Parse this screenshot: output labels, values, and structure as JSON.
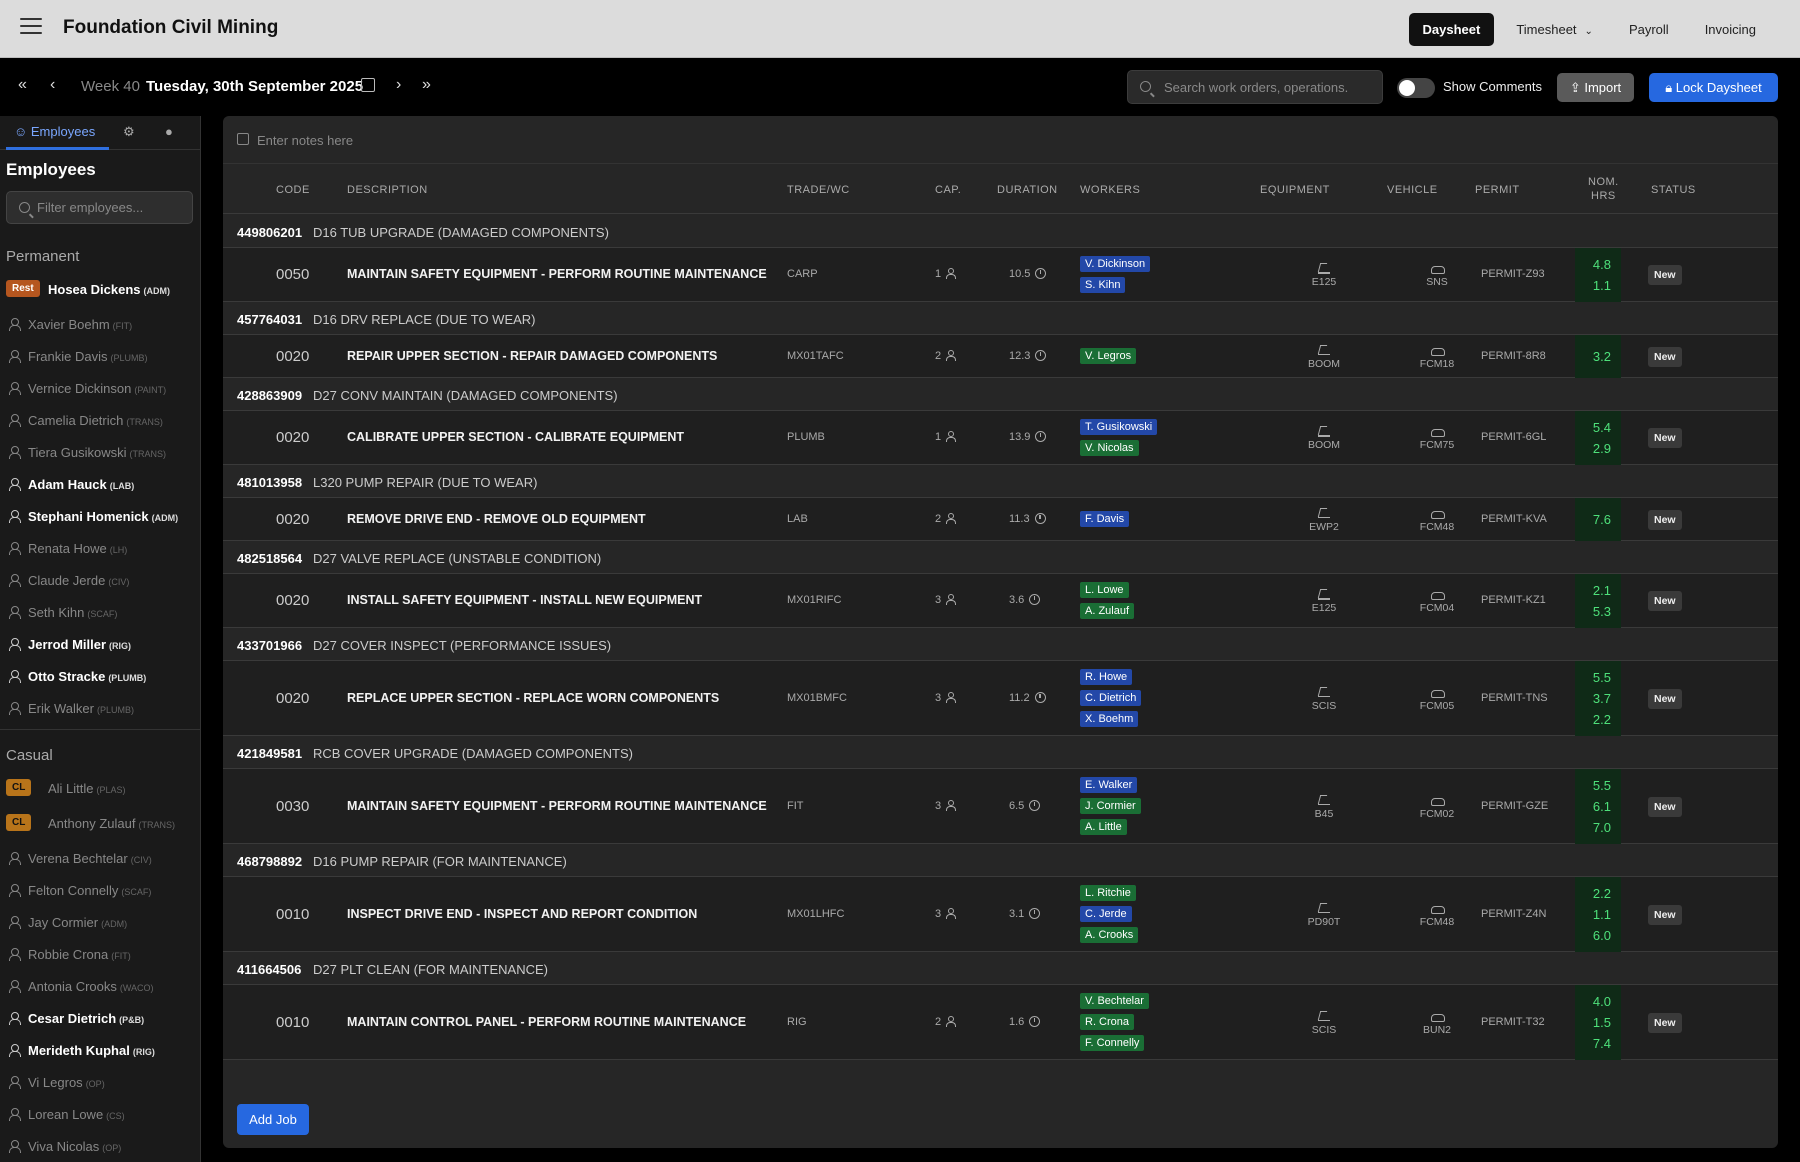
{
  "app": {
    "title": "Foundation Civil Mining"
  },
  "nav": [
    {
      "label": "Daysheet",
      "active": true
    },
    {
      "label": "Timesheet",
      "active": false,
      "dropdown": true
    },
    {
      "label": "Payroll",
      "active": false
    },
    {
      "label": "Invoicing",
      "active": false
    }
  ],
  "weekbar": {
    "week": "Week 40",
    "date": "Tuesday, 30th September 2025",
    "search_placeholder": "Search work orders, operations.",
    "toggle_label": "Show Comments",
    "toggle_on": false,
    "import_label": "Import",
    "lock_label": "Lock Daysheet"
  },
  "sidebar": {
    "tabs": [
      {
        "label": "Employees",
        "icon": "people-icon"
      },
      {
        "label": "",
        "icon": "excavator-icon"
      },
      {
        "label": "",
        "icon": "vehicle-icon"
      }
    ],
    "heading": "Employees",
    "filter_placeholder": "Filter employees...",
    "groups": [
      {
        "title": "Permanent",
        "employees": [
          {
            "name": "Hosea Dickens",
            "role": "(ADM)",
            "bold": true,
            "badge": "Rest"
          },
          {
            "name": "Xavier Boehm",
            "role": "(FIT)",
            "bold": false
          },
          {
            "name": "Frankie Davis",
            "role": "(PLUMB)",
            "bold": false
          },
          {
            "name": "Vernice Dickinson",
            "role": "(PAINT)",
            "bold": false
          },
          {
            "name": "Camelia Dietrich",
            "role": "(TRANS)",
            "bold": false
          },
          {
            "name": "Tiera Gusikowski",
            "role": "(TRANS)",
            "bold": false
          },
          {
            "name": "Adam Hauck",
            "role": "(LAB)",
            "bold": true
          },
          {
            "name": "Stephani Homenick",
            "role": "(ADM)",
            "bold": true
          },
          {
            "name": "Renata Howe",
            "role": "(LH)",
            "bold": false
          },
          {
            "name": "Claude Jerde",
            "role": "(CIV)",
            "bold": false
          },
          {
            "name": "Seth Kihn",
            "role": "(SCAF)",
            "bold": false
          },
          {
            "name": "Jerrod Miller",
            "role": "(RIG)",
            "bold": true
          },
          {
            "name": "Otto Stracke",
            "role": "(PLUMB)",
            "bold": true
          },
          {
            "name": "Erik Walker",
            "role": "(PLUMB)",
            "bold": false
          }
        ]
      },
      {
        "title": "Casual",
        "employees": [
          {
            "name": "Ali Little",
            "role": "(PLAS)",
            "bold": false,
            "badge": "CL"
          },
          {
            "name": "Anthony Zulauf",
            "role": "(TRANS)",
            "bold": false,
            "badge": "CL"
          },
          {
            "name": "Verena Bechtelar",
            "role": "(CIV)",
            "bold": false
          },
          {
            "name": "Felton Connelly",
            "role": "(SCAF)",
            "bold": false
          },
          {
            "name": "Jay Cormier",
            "role": "(ADM)",
            "bold": false
          },
          {
            "name": "Robbie Crona",
            "role": "(FIT)",
            "bold": false
          },
          {
            "name": "Antonia Crooks",
            "role": "(WACO)",
            "bold": false
          },
          {
            "name": "Cesar Dietrich",
            "role": "(P&B)",
            "bold": true
          },
          {
            "name": "Merideth Kuphal",
            "role": "(RIG)",
            "bold": true
          },
          {
            "name": "Vi Legros",
            "role": "(OP)",
            "bold": false
          },
          {
            "name": "Lorean Lowe",
            "role": "(CS)",
            "bold": false
          },
          {
            "name": "Viva Nicolas",
            "role": "(OP)",
            "bold": false
          }
        ]
      }
    ]
  },
  "main": {
    "notes_placeholder": "Enter notes here",
    "columns": {
      "code": "CODE",
      "description": "DESCRIPTION",
      "trade": "TRADE/WC",
      "cap": "CAP.",
      "duration": "DURATION",
      "workers": "WORKERS",
      "equipment": "EQUIPMENT",
      "vehicle": "VEHICLE",
      "permit": "PERMIT",
      "nom_hrs_1": "NOM.",
      "nom_hrs_2": "HRS",
      "status": "STATUS"
    },
    "work_orders": [
      {
        "wo": "449806201",
        "title": "D16 TUB UPGRADE (DAMAGED COMPONENTS)",
        "job": {
          "code": "0050",
          "desc": "MAINTAIN SAFETY EQUIPMENT - PERFORM ROUTINE MAINTENANCE",
          "trade": "CARP",
          "cap": "1",
          "duration": "10.5",
          "workers": [
            {
              "name": "V. Dickinson",
              "color": "blue"
            },
            {
              "name": "S. Kihn",
              "color": "blue"
            }
          ],
          "equipment": "E125",
          "vehicle": "SNS",
          "permit": "PERMIT-Z93",
          "hours": [
            "4.8",
            "1.1"
          ],
          "status": "New"
        }
      },
      {
        "wo": "457764031",
        "title": "D16 DRV REPLACE (DUE TO WEAR)",
        "job": {
          "code": "0020",
          "desc": "REPAIR UPPER SECTION - REPAIR DAMAGED COMPONENTS",
          "trade": "MX01TAFC",
          "cap": "2",
          "duration": "12.3",
          "workers": [
            {
              "name": "V. Legros",
              "color": "green"
            }
          ],
          "equipment": "BOOM",
          "vehicle": "FCM18",
          "permit": "PERMIT-8R8",
          "hours": [
            "3.2"
          ],
          "status": "New"
        }
      },
      {
        "wo": "428863909",
        "title": "D27 CONV MAINTAIN (DAMAGED COMPONENTS)",
        "job": {
          "code": "0020",
          "desc": "CALIBRATE UPPER SECTION - CALIBRATE EQUIPMENT",
          "trade": "PLUMB",
          "cap": "1",
          "duration": "13.9",
          "workers": [
            {
              "name": "T. Gusikowski",
              "color": "blue"
            },
            {
              "name": "V. Nicolas",
              "color": "green"
            }
          ],
          "equipment": "BOOM",
          "vehicle": "FCM75",
          "permit": "PERMIT-6GL",
          "hours": [
            "5.4",
            "2.9"
          ],
          "status": "New"
        }
      },
      {
        "wo": "481013958",
        "title": "L320 PUMP REPAIR (DUE TO WEAR)",
        "job": {
          "code": "0020",
          "desc": "REMOVE DRIVE END - REMOVE OLD EQUIPMENT",
          "trade": "LAB",
          "cap": "2",
          "duration": "11.3",
          "workers": [
            {
              "name": "F. Davis",
              "color": "blue"
            }
          ],
          "equipment": "EWP2",
          "vehicle": "FCM48",
          "permit": "PERMIT-KVA",
          "hours": [
            "7.6"
          ],
          "status": "New"
        }
      },
      {
        "wo": "482518564",
        "title": "D27 VALVE REPLACE (UNSTABLE CONDITION)",
        "job": {
          "code": "0020",
          "desc": "INSTALL SAFETY EQUIPMENT - INSTALL NEW EQUIPMENT",
          "trade": "MX01RIFC",
          "cap": "3",
          "duration": "3.6",
          "workers": [
            {
              "name": "L. Lowe",
              "color": "green"
            },
            {
              "name": "A. Zulauf",
              "color": "green"
            }
          ],
          "equipment": "E125",
          "vehicle": "FCM04",
          "permit": "PERMIT-KZ1",
          "hours": [
            "2.1",
            "5.3"
          ],
          "status": "New"
        }
      },
      {
        "wo": "433701966",
        "title": "D27 COVER INSPECT (PERFORMANCE ISSUES)",
        "job": {
          "code": "0020",
          "desc": "REPLACE UPPER SECTION - REPLACE WORN COMPONENTS",
          "trade": "MX01BMFC",
          "cap": "3",
          "duration": "11.2",
          "workers": [
            {
              "name": "R. Howe",
              "color": "blue"
            },
            {
              "name": "C. Dietrich",
              "color": "blue"
            },
            {
              "name": "X. Boehm",
              "color": "blue"
            }
          ],
          "equipment": "SCIS",
          "vehicle": "FCM05",
          "permit": "PERMIT-TNS",
          "hours": [
            "5.5",
            "3.7",
            "2.2"
          ],
          "status": "New"
        }
      },
      {
        "wo": "421849581",
        "title": "RCB COVER UPGRADE (DAMAGED COMPONENTS)",
        "job": {
          "code": "0030",
          "desc": "MAINTAIN SAFETY EQUIPMENT - PERFORM ROUTINE MAINTENANCE",
          "trade": "FIT",
          "cap": "3",
          "duration": "6.5",
          "workers": [
            {
              "name": "E. Walker",
              "color": "blue"
            },
            {
              "name": "J. Cormier",
              "color": "green"
            },
            {
              "name": "A. Little",
              "color": "green"
            }
          ],
          "equipment": "B45",
          "vehicle": "FCM02",
          "permit": "PERMIT-GZE",
          "hours": [
            "5.5",
            "6.1",
            "7.0"
          ],
          "status": "New"
        }
      },
      {
        "wo": "468798892",
        "title": "D16 PUMP REPAIR (FOR MAINTENANCE)",
        "job": {
          "code": "0010",
          "desc": "INSPECT DRIVE END - INSPECT AND REPORT CONDITION",
          "trade": "MX01LHFC",
          "cap": "3",
          "duration": "3.1",
          "workers": [
            {
              "name": "L. Ritchie",
              "color": "green"
            },
            {
              "name": "C. Jerde",
              "color": "blue"
            },
            {
              "name": "A. Crooks",
              "color": "green"
            }
          ],
          "equipment": "PD90T",
          "vehicle": "FCM48",
          "permit": "PERMIT-Z4N",
          "hours": [
            "2.2",
            "1.1",
            "6.0"
          ],
          "status": "New"
        }
      },
      {
        "wo": "411664506",
        "title": "D27 PLT CLEAN (FOR MAINTENANCE)",
        "job": {
          "code": "0010",
          "desc": "MAINTAIN CONTROL PANEL - PERFORM ROUTINE MAINTENANCE",
          "trade": "RIG",
          "cap": "2",
          "duration": "1.6",
          "workers": [
            {
              "name": "V. Bechtelar",
              "color": "green"
            },
            {
              "name": "R. Crona",
              "color": "green"
            },
            {
              "name": "F. Connelly",
              "color": "green"
            }
          ],
          "equipment": "SCIS",
          "vehicle": "BUN2",
          "permit": "PERMIT-T32",
          "hours": [
            "4.0",
            "1.5",
            "7.4"
          ],
          "status": "New"
        }
      }
    ],
    "add_job_label": "Add Job"
  }
}
